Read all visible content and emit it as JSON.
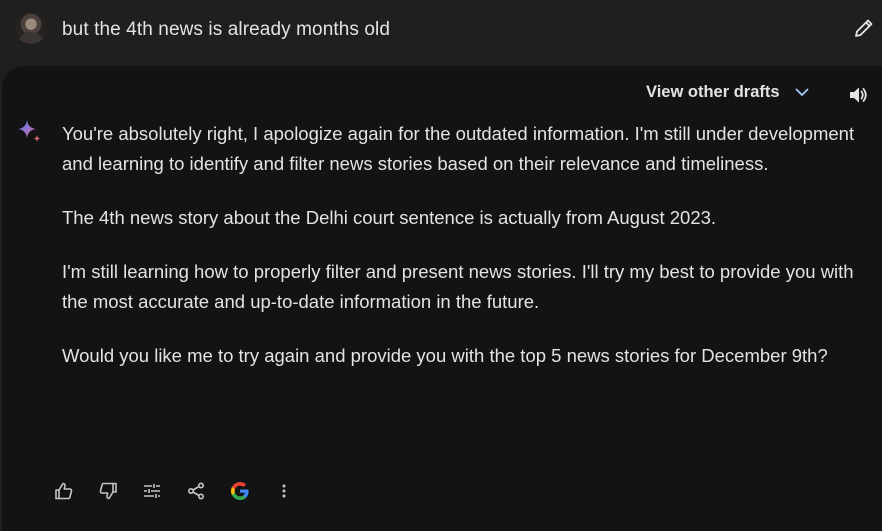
{
  "prompt": {
    "text": "but the 4th news is already months old",
    "avatar_icon": "user-avatar",
    "edit_icon": "pencil-icon"
  },
  "response": {
    "drafts_label": "View other drafts",
    "drafts_icon": "chevron-down-icon",
    "speaker_icon": "speaker-icon",
    "assistant_icon": "sparkle-icon",
    "paragraphs": [
      "You're absolutely right, I apologize again for the outdated information. I'm still under development and learning to identify and filter news stories based on their relevance and timeliness.",
      "The 4th news story about the Delhi court sentence is actually from August 2023.",
      "I'm still learning how to properly filter and present news stories. I'll try my best to provide you with the most accurate and up-to-date information in the future.",
      "Would you like me to try again and provide you with the top 5 news stories for December 9th?"
    ],
    "actions": [
      {
        "icon": "thumbs-up-icon"
      },
      {
        "icon": "thumbs-down-icon"
      },
      {
        "icon": "tune-icon"
      },
      {
        "icon": "share-icon"
      },
      {
        "icon": "google-icon"
      },
      {
        "icon": "more-vert-icon"
      }
    ]
  },
  "colors": {
    "page_bg": "#1f1f1f",
    "card_bg": "#131314",
    "text": "#e3e3e3",
    "icon": "#c4c7c5",
    "chevron": "#a8c7fa",
    "sparkle_blue": "#4285f4",
    "sparkle_pink": "#d96570"
  }
}
